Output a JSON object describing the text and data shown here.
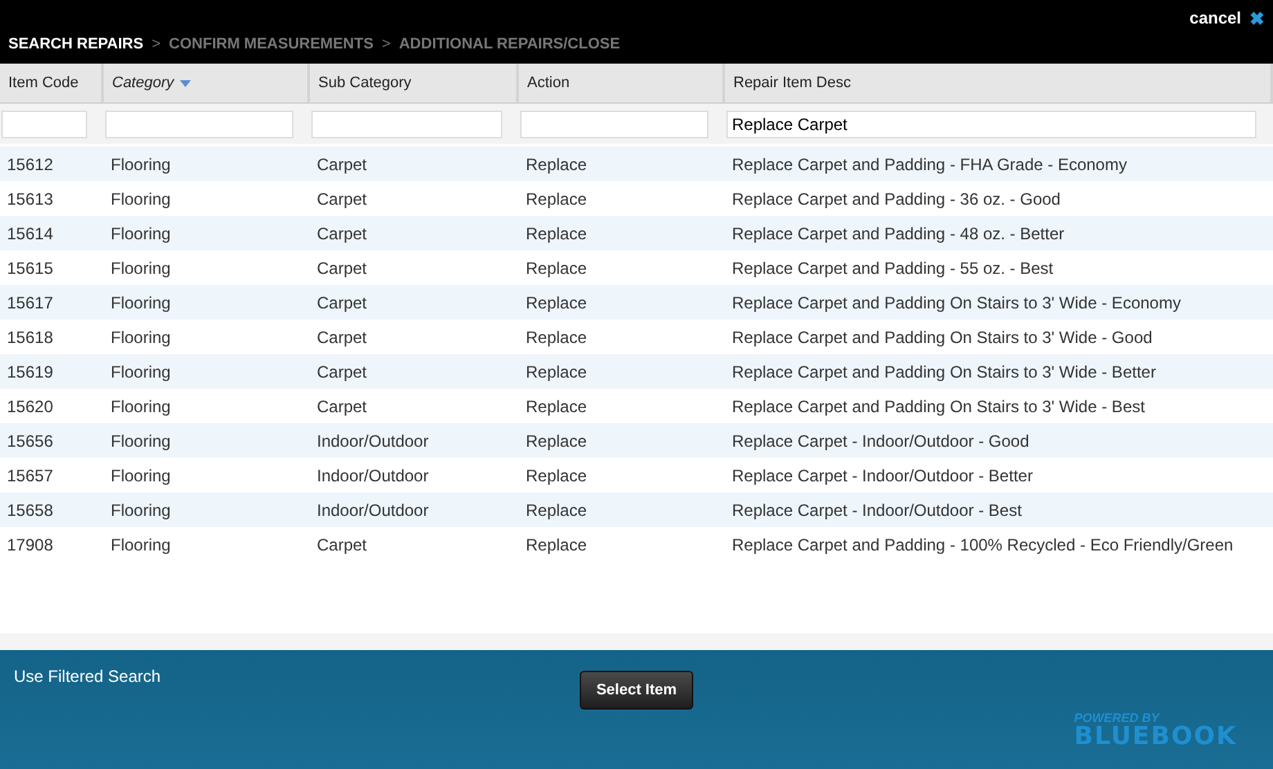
{
  "dialog": {
    "cancel_label": "cancel",
    "close_icon": "✖"
  },
  "breadcrumb": [
    {
      "label": "SEARCH REPAIRS",
      "selected": true
    },
    {
      "label": "CONFIRM MEASUREMENTS",
      "selected": false
    },
    {
      "label": "ADDITIONAL REPAIRS/CLOSE",
      "selected": false
    }
  ],
  "breadcrumb_separator": ">",
  "table": {
    "columns": [
      {
        "label": "Item Code",
        "sorted": false
      },
      {
        "label": "Category",
        "sorted": true
      },
      {
        "label": "Sub Category",
        "sorted": false
      },
      {
        "label": "Action",
        "sorted": false
      },
      {
        "label": "Repair Item Desc",
        "sorted": false,
        "filter": "Replace Carpet"
      }
    ],
    "rows": [
      [
        "15612",
        "Flooring",
        "Carpet",
        "Replace",
        "Replace Carpet and Padding - FHA Grade - Economy"
      ],
      [
        "15613",
        "Flooring",
        "Carpet",
        "Replace",
        "Replace Carpet and Padding - 36 oz. - Good"
      ],
      [
        "15614",
        "Flooring",
        "Carpet",
        "Replace",
        "Replace Carpet and Padding - 48 oz. - Better"
      ],
      [
        "15615",
        "Flooring",
        "Carpet",
        "Replace",
        "Replace Carpet and Padding - 55 oz. - Best"
      ],
      [
        "15617",
        "Flooring",
        "Carpet",
        "Replace",
        "Replace Carpet and Padding On Stairs to 3' Wide - Economy"
      ],
      [
        "15618",
        "Flooring",
        "Carpet",
        "Replace",
        "Replace Carpet and Padding On Stairs to 3' Wide - Good"
      ],
      [
        "15619",
        "Flooring",
        "Carpet",
        "Replace",
        "Replace Carpet and Padding On Stairs to 3' Wide - Better"
      ],
      [
        "15620",
        "Flooring",
        "Carpet",
        "Replace",
        "Replace Carpet and Padding On Stairs to 3' Wide - Best"
      ],
      [
        "15656",
        "Flooring",
        "Indoor/Outdoor",
        "Replace",
        "Replace Carpet - Indoor/Outdoor - Good"
      ],
      [
        "15657",
        "Flooring",
        "Indoor/Outdoor",
        "Replace",
        "Replace Carpet - Indoor/Outdoor - Better"
      ],
      [
        "15658",
        "Flooring",
        "Indoor/Outdoor",
        "Replace",
        "Replace Carpet - Indoor/Outdoor - Best"
      ],
      [
        "17908",
        "Flooring",
        "Carpet",
        "Replace",
        "Replace Carpet and Padding - 100% Recycled - Eco Friendly/Green"
      ]
    ]
  },
  "footer": {
    "link": "Use Filtered Search",
    "button": "Select Item",
    "logo_top": "POWERED BY",
    "logo_bottom": "BLUEBOOK"
  }
}
